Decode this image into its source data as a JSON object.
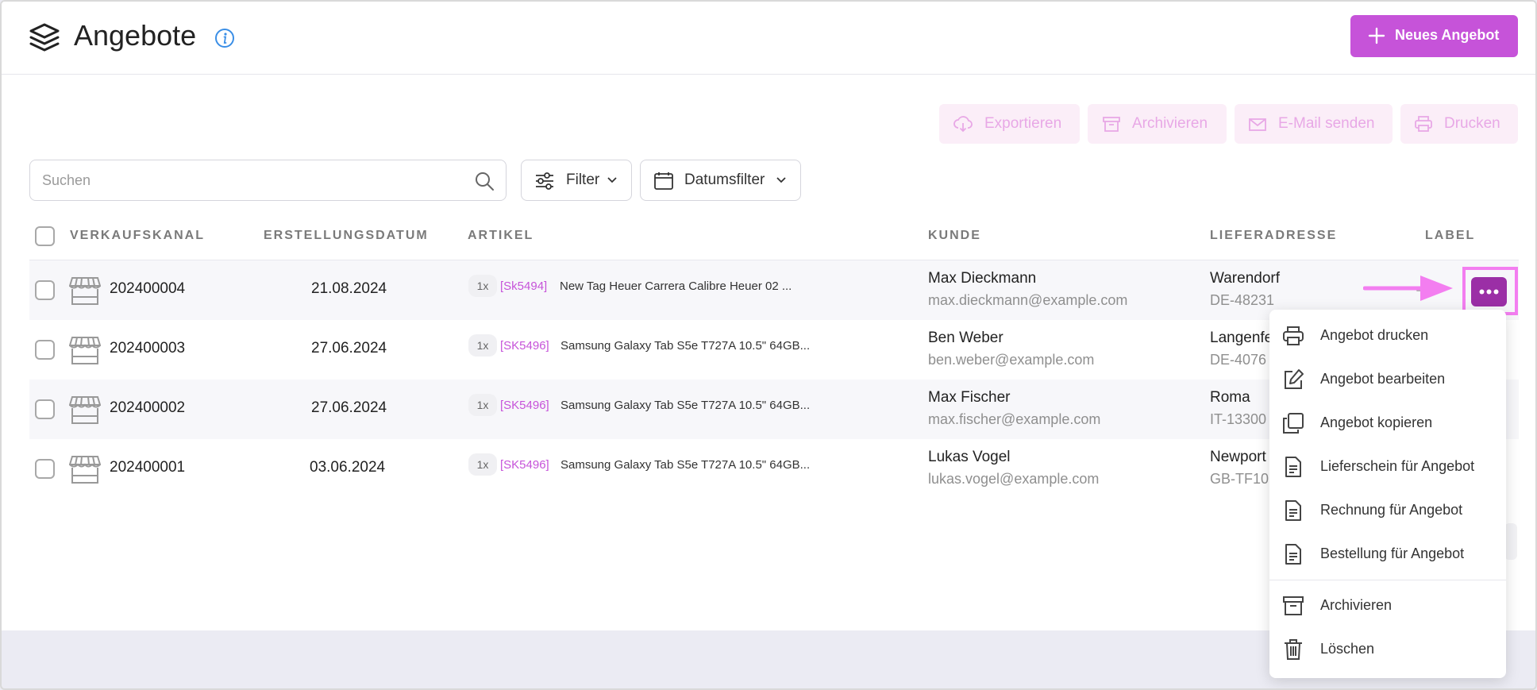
{
  "header": {
    "title": "Angebote",
    "new_button": "Neues Angebot"
  },
  "bulk_actions": {
    "export": "Exportieren",
    "archive": "Archivieren",
    "email": "E-Mail senden",
    "print": "Drucken"
  },
  "toolbar": {
    "search_placeholder": "Suchen",
    "filter": "Filter",
    "date_filter": "Datumsfilter"
  },
  "table": {
    "columns": [
      "VERKAUFSKANAL",
      "ERSTELLUNGSDATUM",
      "ARTIKEL",
      "KUNDE",
      "LIEFERADRESSE",
      "LABEL"
    ],
    "rows": [
      {
        "number": "202400004",
        "date": "21.08.2024",
        "qty": "1x",
        "sku": "[Sk5494]",
        "article": "New Tag Heuer Carrera Calibre Heuer 02 ...",
        "customer": "Max Dieckmann",
        "email": "max.dieckmann@example.com",
        "city": "Warendorf",
        "zip": "DE-48231"
      },
      {
        "number": "202400003",
        "date": "27.06.2024",
        "qty": "1x",
        "sku": "[SK5496]",
        "article": "Samsung Galaxy Tab S5e T727A 10.5\" 64GB...",
        "customer": "Ben Weber",
        "email": "ben.weber@example.com",
        "city": "Langenfe",
        "zip": "DE-4076"
      },
      {
        "number": "202400002",
        "date": "27.06.2024",
        "qty": "1x",
        "sku": "[SK5496]",
        "article": "Samsung Galaxy Tab S5e T727A 10.5\" 64GB...",
        "customer": "Max Fischer",
        "email": "max.fischer@example.com",
        "city": "Roma",
        "zip": "IT-13300"
      },
      {
        "number": "202400001",
        "date": "03.06.2024",
        "qty": "1x",
        "sku": "[SK5496]",
        "article": "Samsung Galaxy Tab S5e T727A 10.5\" 64GB...",
        "customer": "Lukas Vogel",
        "email": "lukas.vogel@example.com",
        "city": "Newport",
        "zip": "GB-TF10"
      }
    ]
  },
  "context_menu": {
    "items": [
      {
        "label": "Angebot drucken",
        "icon": "printer-icon"
      },
      {
        "label": "Angebot bearbeiten",
        "icon": "edit-icon"
      },
      {
        "label": "Angebot kopieren",
        "icon": "copy-icon"
      },
      {
        "label": "Lieferschein für Angebot",
        "icon": "document-icon"
      },
      {
        "label": "Rechnung für Angebot",
        "icon": "document-icon"
      },
      {
        "label": "Bestellung für Angebot",
        "icon": "document-icon"
      },
      {
        "label": "Archivieren",
        "icon": "archive-icon"
      },
      {
        "label": "Löschen",
        "icon": "trash-icon"
      }
    ]
  },
  "colors": {
    "accent": "#c653d9",
    "accent_dark": "#9b2fa6",
    "annotation": "#f37ef0"
  }
}
